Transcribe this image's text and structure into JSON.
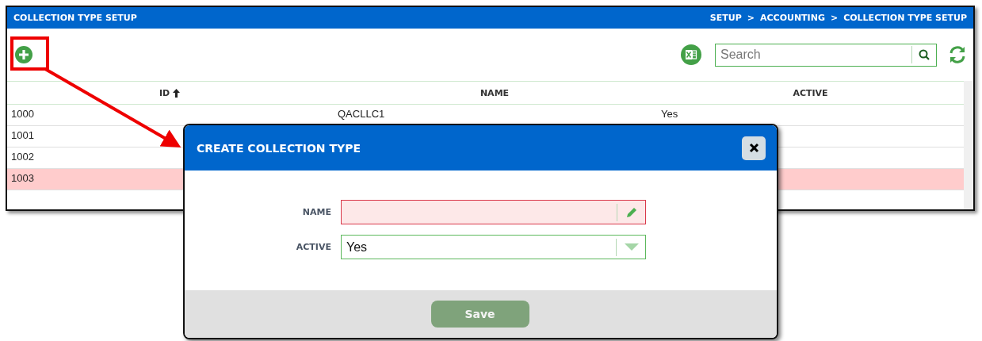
{
  "window": {
    "title": "COLLECTION TYPE SETUP",
    "breadcrumb": [
      "SETUP",
      "ACCOUNTING",
      "COLLECTION TYPE SETUP"
    ],
    "breadcrumb_separator": ">"
  },
  "toolbar": {
    "search": {
      "placeholder": "Search"
    }
  },
  "table": {
    "columns": [
      {
        "label": "ID",
        "sorted_ascending": true
      },
      {
        "label": "NAME"
      },
      {
        "label": "ACTIVE"
      }
    ],
    "rows": [
      {
        "id": "1000",
        "name": "QACLLC1",
        "active": "Yes",
        "selected": false
      },
      {
        "id": "1001",
        "selected": false
      },
      {
        "id": "1002",
        "selected": false
      },
      {
        "id": "1003",
        "selected": true
      }
    ]
  },
  "dialog": {
    "title": "CREATE COLLECTION TYPE",
    "fields": [
      {
        "kind": "text",
        "label": "NAME",
        "invalid": true
      },
      {
        "kind": "select",
        "label": "ACTIVE",
        "value": "Yes",
        "invalid": false
      }
    ],
    "save": "Save"
  }
}
